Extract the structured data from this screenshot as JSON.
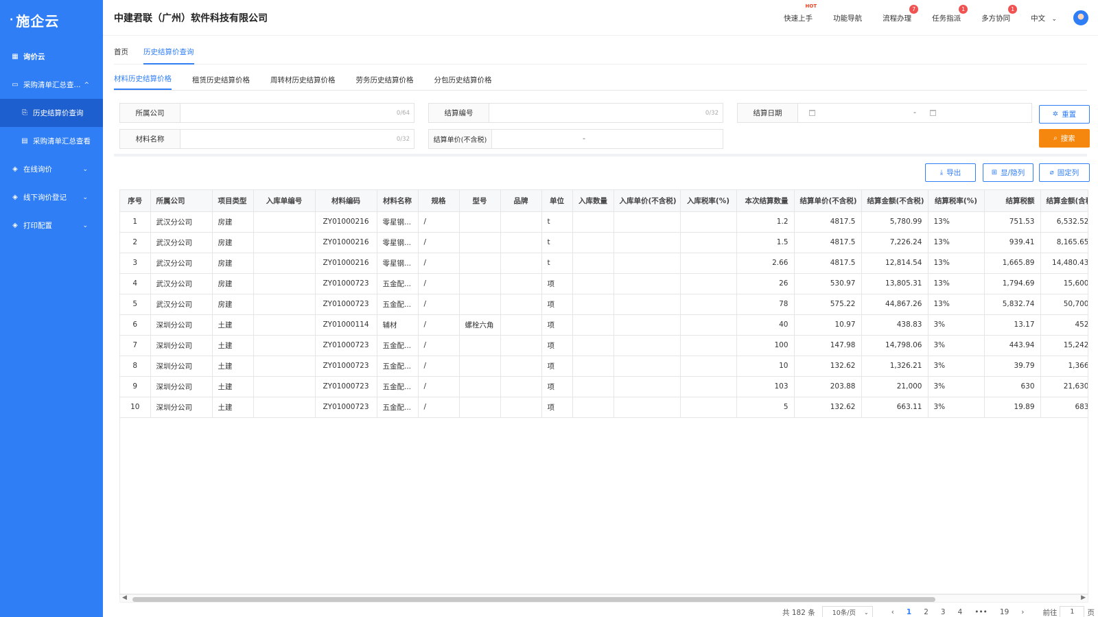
{
  "sidebar": {
    "logo": "施企云",
    "items": [
      {
        "label": "询价云",
        "icon": "grid-icon",
        "chev": ""
      },
      {
        "label": "采购清单汇总查...",
        "icon": "folder-icon",
        "chev": "^"
      },
      {
        "label": "历史结算价查询",
        "icon": "document-search-icon",
        "chev": ""
      },
      {
        "label": "采购清单汇总查看",
        "icon": "table-icon",
        "chev": ""
      },
      {
        "label": "在线询价",
        "icon": "layers-icon",
        "chev": "⌄"
      },
      {
        "label": "线下询价登记",
        "icon": "layers-icon",
        "chev": "⌄"
      },
      {
        "label": "打印配置",
        "icon": "layers-icon",
        "chev": "⌄"
      }
    ]
  },
  "header": {
    "company": "中建君联（广州）软件科技有限公司",
    "links": [
      {
        "label": "快速上手",
        "badge": "HOT"
      },
      {
        "label": "功能导航",
        "badge": ""
      },
      {
        "label": "流程办理",
        "badge": "7"
      },
      {
        "label": "任务指派",
        "badge": "1"
      },
      {
        "label": "多方协同",
        "badge": "1"
      }
    ],
    "lang": "中文"
  },
  "breadcrumb": [
    "首页",
    "历史结算价查询"
  ],
  "subtabs": [
    "材料历史结算价格",
    "租赁历史结算价格",
    "周转材历史结算价格",
    "劳务历史结算价格",
    "分包历史结算价格"
  ],
  "filters": {
    "company": {
      "label": "所属公司",
      "count": "0/64"
    },
    "settle_no": {
      "label": "结算编号",
      "count": "0/32"
    },
    "settle_date": {
      "label": "结算日期",
      "sep": "-"
    },
    "material": {
      "label": "材料名称",
      "count": "0/32"
    },
    "price": {
      "label": "结算单价(不含税)",
      "sep": "-"
    }
  },
  "buttons": {
    "reset": "重置",
    "search": "搜索",
    "export": "导出",
    "toggle_cols": "显/隐列",
    "fix_cols": "固定列"
  },
  "table": {
    "columns": [
      "序号",
      "所属公司",
      "项目类型",
      "入库单编号",
      "材料编码",
      "材料名称",
      "规格",
      "型号",
      "品牌",
      "单位",
      "入库数量",
      "入库单价(不含税)",
      "入库税率(%)",
      "本次结算数量",
      "结算单价(不含税)",
      "结算金额(不含税)",
      "结算税率(%)",
      "结算税额",
      "结算金额(含税)"
    ],
    "rows": [
      [
        "1",
        "武汉分公司",
        "房建",
        "",
        "ZY01000216",
        "零星钢...",
        "/",
        "",
        "",
        "t",
        "",
        "",
        "",
        "1.2",
        "4817.5",
        "5,780.99",
        "13%",
        "751.53",
        "6,532.52"
      ],
      [
        "2",
        "武汉分公司",
        "房建",
        "",
        "ZY01000216",
        "零星钢...",
        "/",
        "",
        "",
        "t",
        "",
        "",
        "",
        "1.5",
        "4817.5",
        "7,226.24",
        "13%",
        "939.41",
        "8,165.65"
      ],
      [
        "3",
        "武汉分公司",
        "房建",
        "",
        "ZY01000216",
        "零星钢...",
        "/",
        "",
        "",
        "t",
        "",
        "",
        "",
        "2.66",
        "4817.5",
        "12,814.54",
        "13%",
        "1,665.89",
        "14,480.43"
      ],
      [
        "4",
        "武汉分公司",
        "房建",
        "",
        "ZY01000723",
        "五金配...",
        "/",
        "",
        "",
        "项",
        "",
        "",
        "",
        "26",
        "530.97",
        "13,805.31",
        "13%",
        "1,794.69",
        "15,600"
      ],
      [
        "5",
        "武汉分公司",
        "房建",
        "",
        "ZY01000723",
        "五金配...",
        "/",
        "",
        "",
        "项",
        "",
        "",
        "",
        "78",
        "575.22",
        "44,867.26",
        "13%",
        "5,832.74",
        "50,700"
      ],
      [
        "6",
        "深圳分公司",
        "土建",
        "",
        "ZY01000114",
        "辅材",
        "/",
        "螺栓六角",
        "",
        "项",
        "",
        "",
        "",
        "40",
        "10.97",
        "438.83",
        "3%",
        "13.17",
        "452"
      ],
      [
        "7",
        "深圳分公司",
        "土建",
        "",
        "ZY01000723",
        "五金配...",
        "/",
        "",
        "",
        "项",
        "",
        "",
        "",
        "100",
        "147.98",
        "14,798.06",
        "3%",
        "443.94",
        "15,242"
      ],
      [
        "8",
        "深圳分公司",
        "土建",
        "",
        "ZY01000723",
        "五金配...",
        "/",
        "",
        "",
        "项",
        "",
        "",
        "",
        "10",
        "132.62",
        "1,326.21",
        "3%",
        "39.79",
        "1,366"
      ],
      [
        "9",
        "深圳分公司",
        "土建",
        "",
        "ZY01000723",
        "五金配...",
        "/",
        "",
        "",
        "项",
        "",
        "",
        "",
        "103",
        "203.88",
        "21,000",
        "3%",
        "630",
        "21,630"
      ],
      [
        "10",
        "深圳分公司",
        "土建",
        "",
        "ZY01000723",
        "五金配...",
        "/",
        "",
        "",
        "项",
        "",
        "",
        "",
        "5",
        "132.62",
        "663.11",
        "3%",
        "19.89",
        "683"
      ]
    ]
  },
  "pager": {
    "total": "共 182 条",
    "size": "10条/页",
    "pages": [
      "1",
      "2",
      "3",
      "4",
      "•••",
      "19"
    ],
    "goto": "前往",
    "page_val": "1",
    "unit": "页"
  }
}
